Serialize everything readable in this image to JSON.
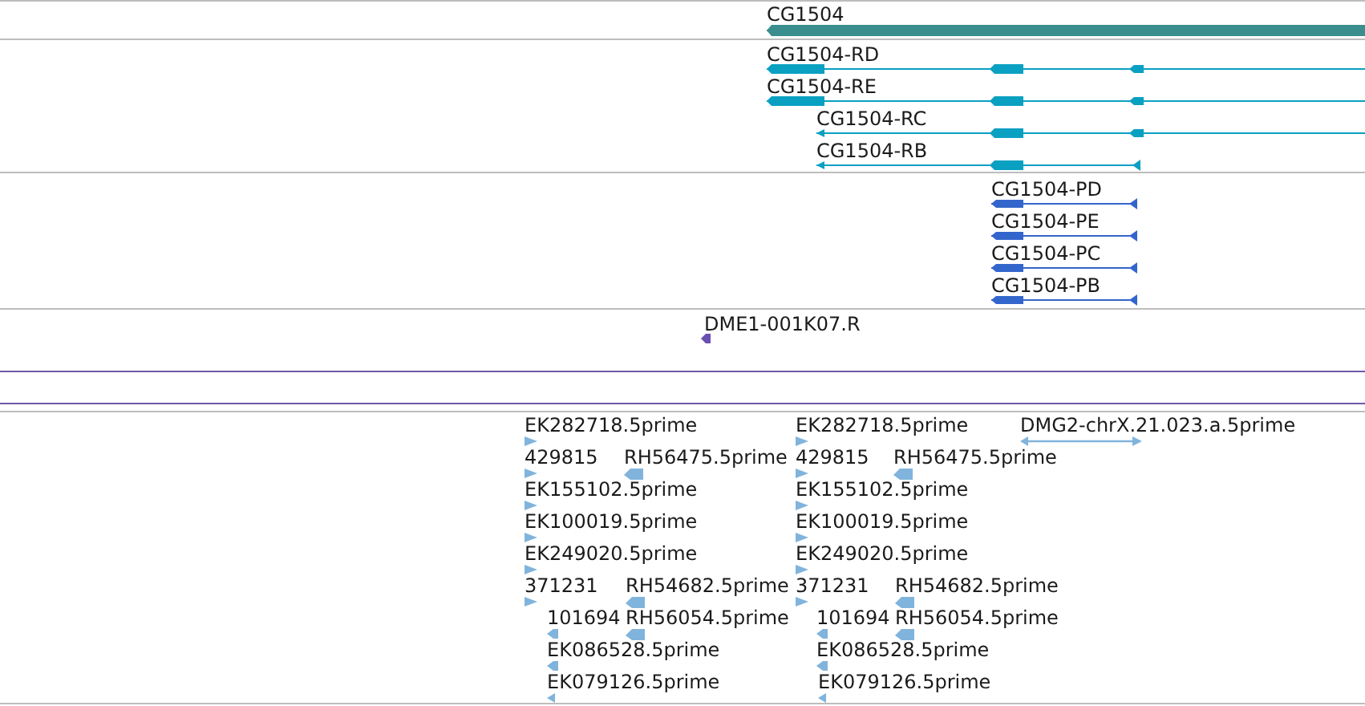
{
  "tracks": [
    {
      "kind": "gene",
      "features": [
        {
          "label": "CG1504"
        }
      ]
    },
    {
      "kind": "transcript",
      "features": [
        {
          "label": "CG1504-RD"
        },
        {
          "label": "CG1504-RE"
        },
        {
          "label": "CG1504-RC"
        },
        {
          "label": "CG1504-RB"
        }
      ]
    },
    {
      "kind": "protein",
      "features": [
        {
          "label": "CG1504-PD"
        },
        {
          "label": "CG1504-PE"
        },
        {
          "label": "CG1504-PC"
        },
        {
          "label": "CG1504-PB"
        }
      ]
    },
    {
      "kind": "clone",
      "features": [
        {
          "label": "DME1-001K07.R"
        }
      ]
    },
    {
      "kind": "spacer"
    },
    {
      "kind": "est",
      "features": [
        {
          "label": "EK282718.5prime"
        },
        {
          "label": "EK282718.5prime"
        },
        {
          "label": "DMG2-chrX.21.023.a.5prime"
        },
        {
          "label": "429815"
        },
        {
          "label": "RH56475.5prime"
        },
        {
          "label": "429815"
        },
        {
          "label": "RH56475.5prime"
        },
        {
          "label": "EK155102.5prime"
        },
        {
          "label": "EK155102.5prime"
        },
        {
          "label": "EK100019.5prime"
        },
        {
          "label": "EK100019.5prime"
        },
        {
          "label": "EK249020.5prime"
        },
        {
          "label": "EK249020.5prime"
        },
        {
          "label": "371231"
        },
        {
          "label": "RH54682.5prime"
        },
        {
          "label": "371231"
        },
        {
          "label": "RH54682.5prime"
        },
        {
          "label": "101694"
        },
        {
          "label": "RH56054.5prime"
        },
        {
          "label": "101694"
        },
        {
          "label": "RH56054.5prime"
        },
        {
          "label": "EK086528.5prime"
        },
        {
          "label": "EK086528.5prime"
        },
        {
          "label": "EK079126.5prime"
        },
        {
          "label": "EK079126.5prime"
        }
      ]
    }
  ]
}
